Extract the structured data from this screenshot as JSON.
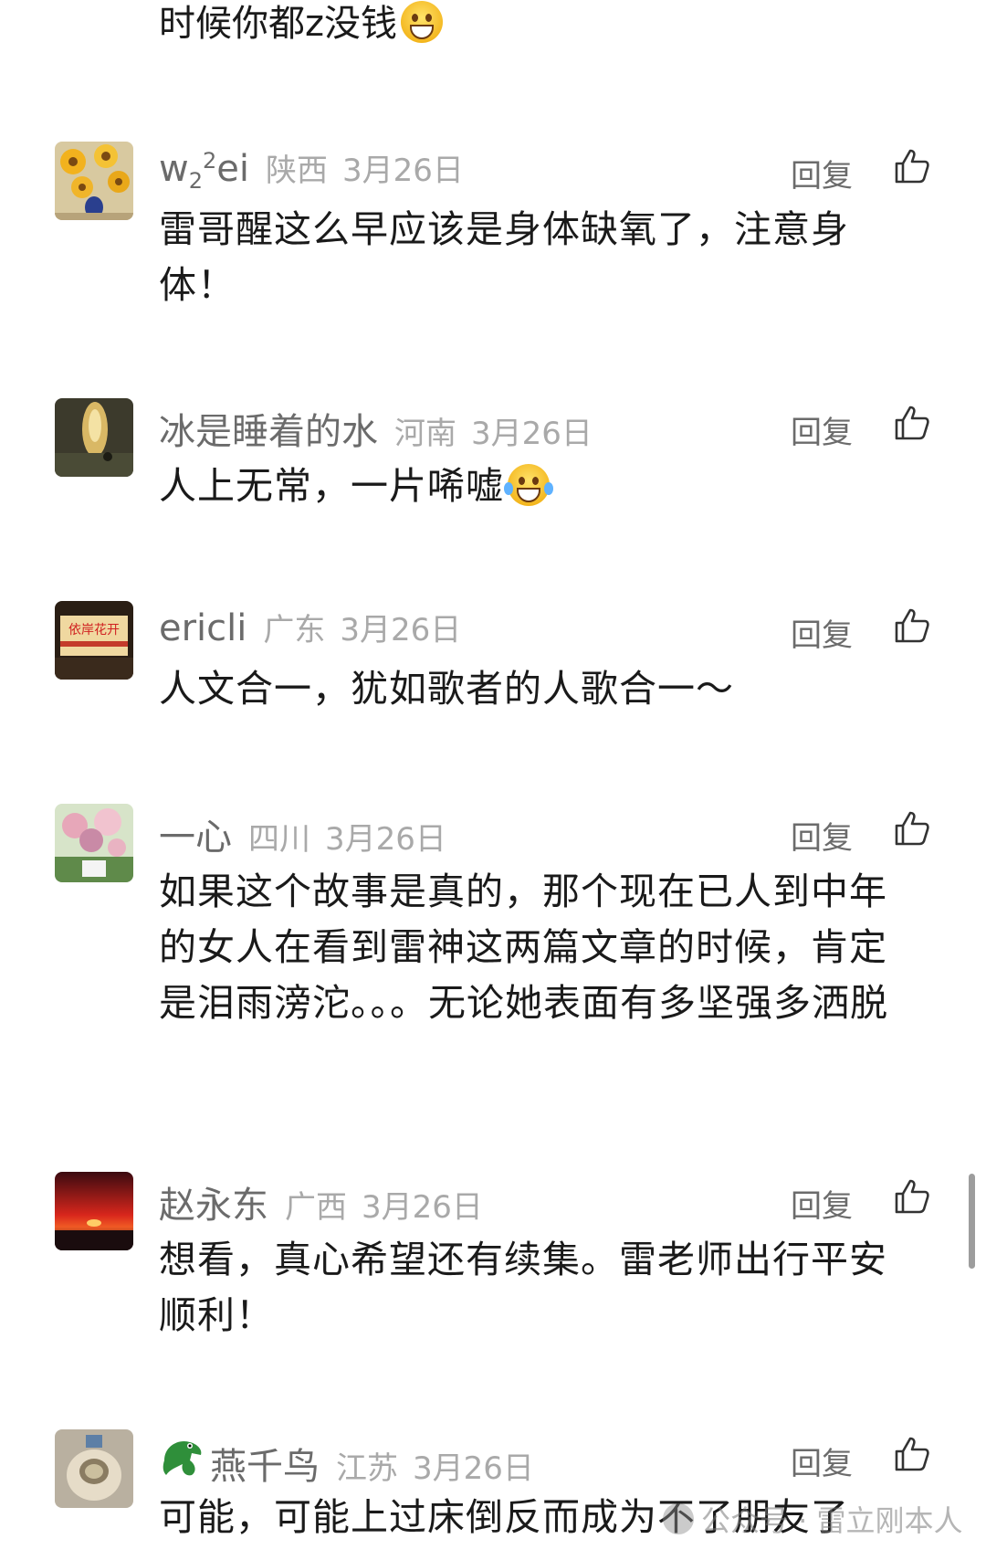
{
  "top_fragment": "时候你都z没钱",
  "reply_label": "回复",
  "comments": [
    {
      "name_main": "w",
      "name_sub": "2",
      "name_sup": "2",
      "name_tail": "ei",
      "location": "陕西",
      "date": "3月26日",
      "text": "雷哥醒这么早应该是身体缺氧了，注意身体！"
    },
    {
      "name": "冰是睡着的水",
      "location": "河南",
      "date": "3月26日",
      "text": "人上无常，一片唏嘘"
    },
    {
      "name": "ericli",
      "location": "广东",
      "date": "3月26日",
      "text": "人文合一，犹如歌者的人歌合一～",
      "avatar_text": "依岸花开"
    },
    {
      "name": "一心",
      "location": "四川",
      "date": "3月26日",
      "text": "如果这个故事是真的，那个现在已人到中年的女人在看到雷神这两篇文章的时候，肯定是泪雨滂沱。。。无论她表面有多坚强多洒脱"
    },
    {
      "name": "赵永东",
      "location": "广西",
      "date": "3月26日",
      "text": "想看，真心希望还有续集。雷老师出行平安顺利！"
    },
    {
      "name": "燕千鸟",
      "location": "江苏",
      "date": "3月26日",
      "text": "可能，可能上过床倒反而成为不了朋友了"
    }
  ],
  "watermark": "公众号 · 雷立刚本人"
}
